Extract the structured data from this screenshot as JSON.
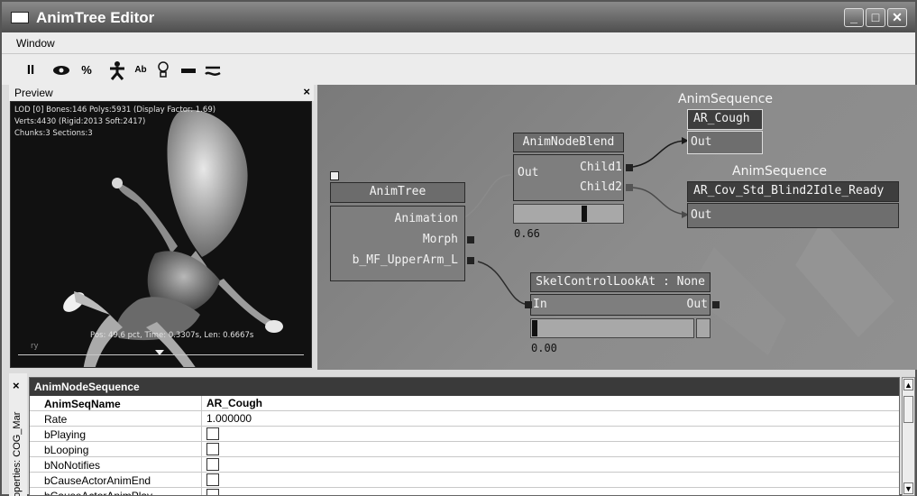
{
  "window": {
    "title": "AnimTree Editor",
    "controls": {
      "minimize": "_",
      "maximize": "□",
      "close": "✕"
    }
  },
  "menu": {
    "items": [
      {
        "label": "Window"
      }
    ]
  },
  "toolbar": {
    "buttons": [
      {
        "icon": "pause-icon",
        "glyph": "II"
      },
      {
        "icon": "eye-icon",
        "glyph": ""
      },
      {
        "icon": "percent-icon",
        "glyph": "%"
      },
      {
        "icon": "skeleton-icon",
        "glyph": ""
      },
      {
        "icon": "text-ab-icon",
        "glyph": "Ab"
      },
      {
        "icon": "bulb-icon",
        "glyph": ""
      },
      {
        "icon": "bar-icon",
        "glyph": ""
      },
      {
        "icon": "wave-icon",
        "glyph": ""
      }
    ]
  },
  "preview": {
    "title": "Preview",
    "close": "×",
    "stats": [
      "LOD [0] Bones:146 Polys:5931 (Display Factor: 1.69)",
      "Verts:4430 (Rigid:2013 Soft:2417)",
      "Chunks:3 Sections:3"
    ],
    "playback": "Pos: 49.6 pct, Time: 0.3307s, Len: 0.6667s",
    "axis_label": "ry"
  },
  "graph": {
    "anim_tree": {
      "title": "AnimTree",
      "pins": [
        "Animation",
        "Morph",
        "b_MF_UpperArm_L"
      ]
    },
    "blend": {
      "title": "AnimNodeBlend",
      "out": "Out",
      "children": [
        "Child1",
        "Child2"
      ],
      "weight": 0.66,
      "weight_text": "0.66"
    },
    "seq1": {
      "header": "AnimSequence",
      "title": "AR_Cough",
      "out": "Out"
    },
    "seq2": {
      "header": "AnimSequence",
      "title": "AR_Cov_Std_Blind2Idle_Ready",
      "out": "Out"
    },
    "skel": {
      "title": "SkelControlLookAt : None",
      "in": "In",
      "out": "Out",
      "strength": 0.0,
      "strength_text": "0.00"
    }
  },
  "properties": {
    "side_label": "Properties: COG_Mar",
    "close": "×",
    "header": "AnimNodeSequence",
    "rows": [
      {
        "name": "AnimSeqName",
        "value": "AR_Cough",
        "bold": true
      },
      {
        "name": "Rate",
        "value": "1.000000"
      },
      {
        "name": "bPlaying",
        "checkbox": true,
        "checked": false
      },
      {
        "name": "bLooping",
        "checkbox": true,
        "checked": false
      },
      {
        "name": "bNoNotifies",
        "checkbox": true,
        "checked": false
      },
      {
        "name": "bCauseActorAnimEnd",
        "checkbox": true,
        "checked": false
      },
      {
        "name": "bCauseActorAnimPlay",
        "checkbox": true,
        "checked": false
      }
    ]
  },
  "colors": {
    "title_bar": "#5a5a5a",
    "graph_bg": "#858585",
    "node_body": "#7e7e7e",
    "header_dark": "#3a3a3a"
  }
}
